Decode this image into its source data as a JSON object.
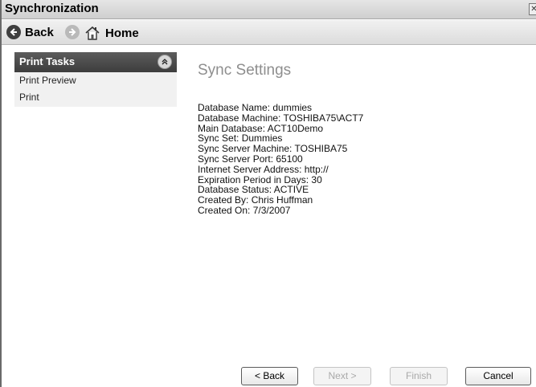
{
  "window": {
    "title": "Synchronization",
    "close_glyph": "✕"
  },
  "nav": {
    "back_label": "Back",
    "home_label": "Home"
  },
  "sidebar": {
    "header": "Print Tasks",
    "items": [
      {
        "label": "Print Preview"
      },
      {
        "label": "Print"
      }
    ]
  },
  "main": {
    "title": "Sync Settings",
    "details": [
      "Database Name: dummies",
      "Database Machine: TOSHIBA75\\ACT7",
      "Main Database: ACT10Demo",
      "Sync Set: Dummies",
      "Sync Server Machine: TOSHIBA75",
      "Sync Server Port: 65100",
      "Internet Server Address: http://",
      "Expiration Period in Days: 30",
      "Database Status: ACTIVE",
      "Created By: Chris Huffman",
      "Created On: 7/3/2007"
    ]
  },
  "buttons": {
    "back": "< Back",
    "next": "Next >",
    "finish": "Finish",
    "cancel": "Cancel"
  }
}
